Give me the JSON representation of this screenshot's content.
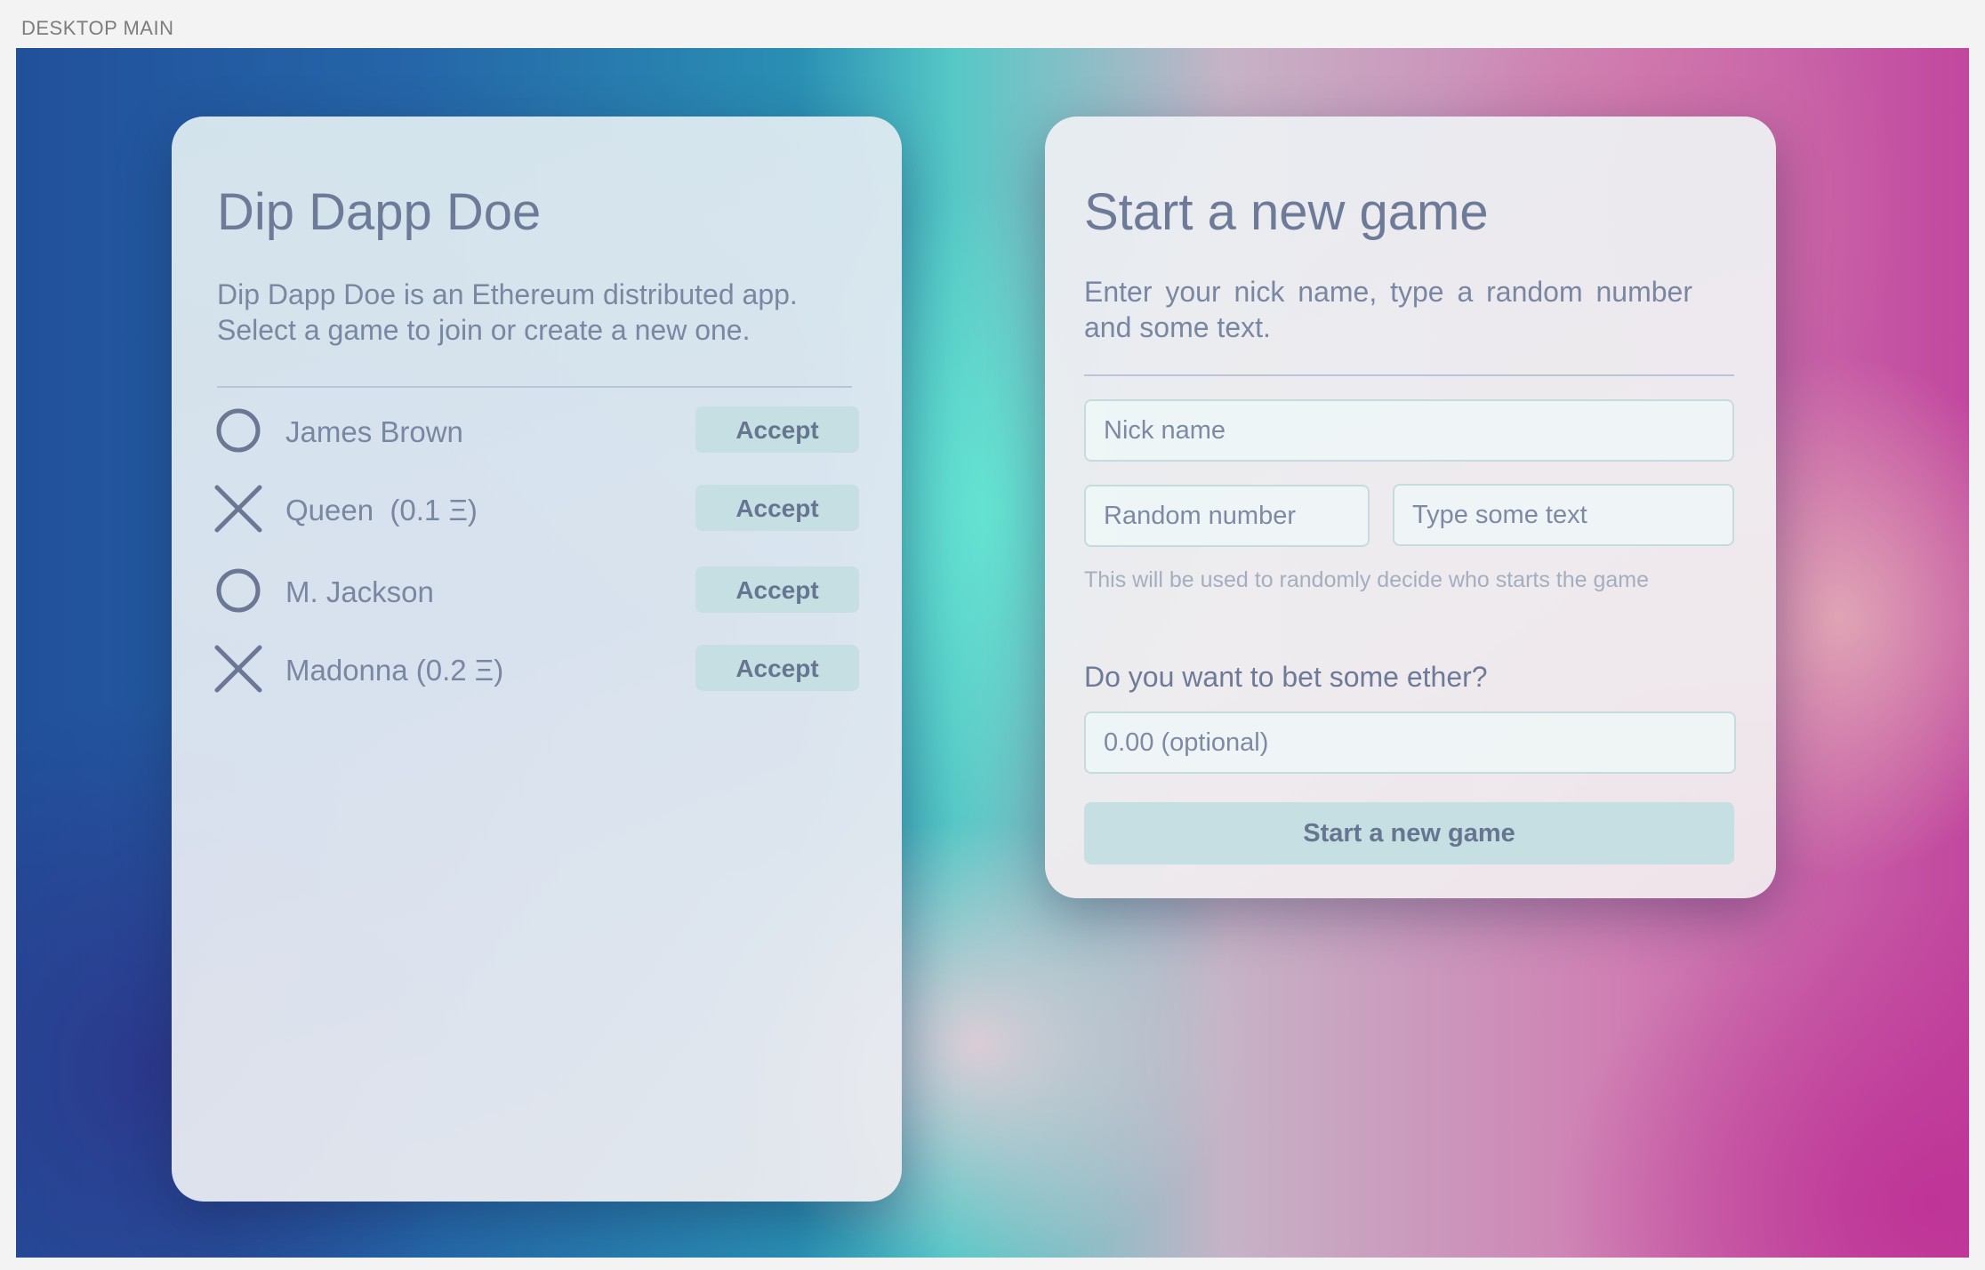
{
  "window": {
    "frame_label": "DESKTOP MAIN"
  },
  "games_panel": {
    "title": "Dip Dapp Doe",
    "description": "Dip Dapp Doe is an Ethereum distributed app. Select a game to join or create a new one.",
    "games": [
      {
        "mark": "circle-icon",
        "name": "James Brown",
        "action": "Accept"
      },
      {
        "mark": "cross-icon",
        "name": "Queen  (0.1 Ξ)",
        "action": "Accept"
      },
      {
        "mark": "circle-icon",
        "name": "M. Jackson",
        "action": "Accept"
      },
      {
        "mark": "cross-icon",
        "name": "Madonna (0.2 Ξ)",
        "action": "Accept"
      }
    ]
  },
  "new_game_panel": {
    "title": "Start a new game",
    "description": "Enter your nick name, type a random number and some text.",
    "nick_name": {
      "value": "",
      "placeholder": "Nick name"
    },
    "random_number": {
      "value": "",
      "placeholder": "Random number"
    },
    "random_text": {
      "value": "",
      "placeholder": "Type some text"
    },
    "helper_text": "This will be used to randomly decide who starts the game",
    "bet_label": "Do you want to bet some ether?",
    "bet_amount": {
      "value": "",
      "placeholder": "0.00 (optional)"
    },
    "submit_label": "Start a new game"
  },
  "colors": {
    "text": "#6e7b98",
    "button_bg": "#c6dfe2",
    "button_text": "#667590",
    "mark": "#6b7793",
    "divider": "#b9c5d8"
  }
}
